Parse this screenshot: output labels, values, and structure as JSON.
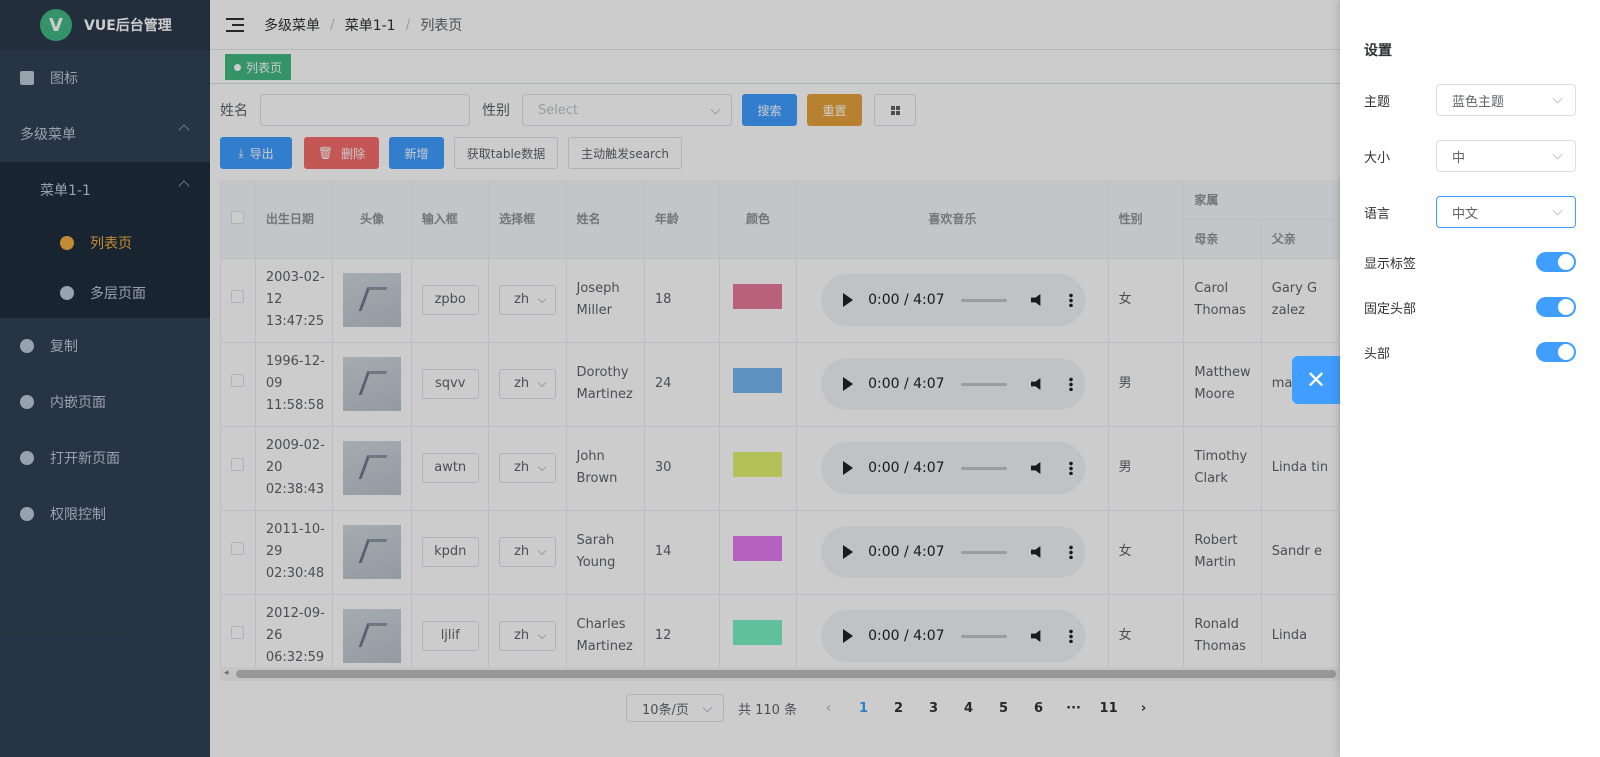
{
  "logo": {
    "mark": "V",
    "title": "VUE后台管理"
  },
  "sidebar": {
    "items": [
      {
        "label": "图标"
      },
      {
        "label": "多级菜单"
      },
      {
        "label": "菜单1-1"
      },
      {
        "label": "列表页"
      },
      {
        "label": "多层页面"
      },
      {
        "label": "复制"
      },
      {
        "label": "内嵌页面"
      },
      {
        "label": "打开新页面"
      },
      {
        "label": "权限控制"
      }
    ]
  },
  "breadcrumb": {
    "items": [
      "多级菜单",
      "菜单1-1",
      "列表页"
    ],
    "sep": "/"
  },
  "tags": {
    "active": "列表页"
  },
  "search": {
    "name_label": "姓名",
    "gender_label": "性别",
    "gender_placeholder": "Select",
    "search_btn": "搜索",
    "reset_btn": "重置"
  },
  "toolbar": {
    "export": "导出",
    "delete": "删除",
    "add": "新增",
    "get_table": "获取table数据",
    "trigger_search": "主动触发search"
  },
  "table": {
    "headers": {
      "birth": "出生日期",
      "avatar": "头像",
      "input": "输入框",
      "select": "选择框",
      "name": "姓名",
      "age": "年龄",
      "color": "颜色",
      "music": "喜欢音乐",
      "gender": "性别",
      "family": "家属",
      "mother": "母亲",
      "father": "父亲"
    },
    "rows": [
      {
        "birth": "2003-02-12 13:47:25",
        "input": "zpbo",
        "select": "zh",
        "name": "Joseph Miller",
        "age": "18",
        "color": "#e8789a",
        "audio": "0:00 / 4:07",
        "gender": "女",
        "mother": "Carol Thomas",
        "father": "Gary G zalez"
      },
      {
        "birth": "1996-12-09 11:58:58",
        "input": "sqvv",
        "select": "zh",
        "name": "Dorothy Martinez",
        "age": "24",
        "color": "#78b7f0",
        "audio": "0:00 / 4:07",
        "gender": "男",
        "mother": "Matthew Moore",
        "father": "mas"
      },
      {
        "birth": "2009-02-20 02:38:43",
        "input": "awtn",
        "select": "zh",
        "name": "John Brown",
        "age": "30",
        "color": "#dff26e",
        "audio": "0:00 / 4:07",
        "gender": "男",
        "mother": "Timothy Clark",
        "father": "Linda tin"
      },
      {
        "birth": "2011-10-29 02:30:48",
        "input": "kpdn",
        "select": "zh",
        "name": "Sarah Young",
        "age": "14",
        "color": "#e47af0",
        "audio": "0:00 / 4:07",
        "gender": "女",
        "mother": "Robert Martin",
        "father": "Sandr e"
      },
      {
        "birth": "2012-09-26 06:32:59",
        "input": "ljlif",
        "select": "zh",
        "name": "Charles Martinez",
        "age": "12",
        "color": "#78f0c4",
        "audio": "0:00 / 4:07",
        "gender": "女",
        "mother": "Ronald Thomas",
        "father": "Linda"
      }
    ]
  },
  "pagination": {
    "page_size": "10条/页",
    "total": "共 110 条",
    "pages": [
      "1",
      "2",
      "3",
      "4",
      "5",
      "6",
      "···",
      "11"
    ],
    "current": "1"
  },
  "settings": {
    "title": "设置",
    "theme_label": "主题",
    "theme_value": "蓝色主题",
    "size_label": "大小",
    "size_value": "中",
    "lang_label": "语言",
    "lang_value": "中文",
    "show_tags_label": "显示标签",
    "fixed_header_label": "固定头部",
    "header_label": "头部"
  }
}
